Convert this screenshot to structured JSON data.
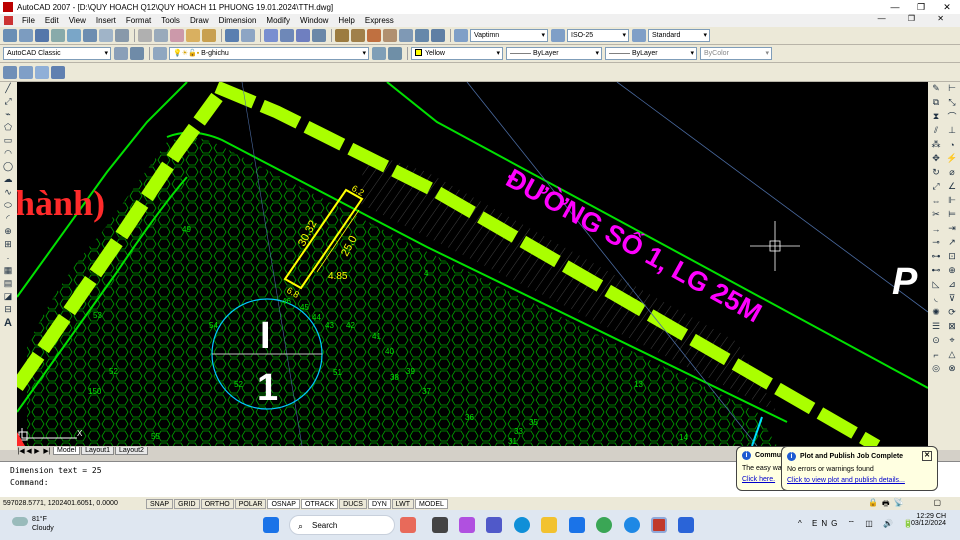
{
  "window": {
    "title": "AutoCAD 2007 - [D:\\QUY HOACH Q12\\QUY HOACH 11 PHUONG 19.01.2024\\TTH.dwg]",
    "controls": [
      "—",
      "❐",
      "✕"
    ]
  },
  "menu": {
    "items": [
      "File",
      "Edit",
      "View",
      "Insert",
      "Format",
      "Tools",
      "Draw",
      "Dimension",
      "Modify",
      "Window",
      "Help",
      "Express"
    ],
    "doc_controls": "— ❐ ✕"
  },
  "toolbars": {
    "text_style": "Vaptimn",
    "dim_style": "ISO-25",
    "table_style": "Standard",
    "workspace": "AutoCAD Classic",
    "layer": "B-ghichu",
    "color": "Yellow",
    "linetype": "ByLayer",
    "lineweight": "ByLayer",
    "plotstyle": "ByColor",
    "accent_yellow": "#ffff00"
  },
  "drawing": {
    "street_label": "ĐƯỜNG SỐ 1, LG 25M",
    "left_text": "hành)",
    "right_letter": "P",
    "block_roman": "I",
    "block_number": "1",
    "dims": {
      "a": "30.32",
      "b": "25.0",
      "c": "4.85",
      "d": "6.2",
      "e": "6.8"
    },
    "lot_numbers": [
      "49",
      "53",
      "54",
      "52",
      "46",
      "45",
      "44",
      "43",
      "42",
      "41",
      "40",
      "39",
      "38",
      "37",
      "36",
      "35",
      "33",
      "31",
      "51",
      "150",
      "55",
      "4",
      "13",
      "14",
      "52"
    ],
    "colors": {
      "road": "#aaff00",
      "boundary": "#00e000",
      "text": "#ff00ff",
      "yellow": "#ffff00",
      "white": "#ffffff",
      "red": "#ff2a2a"
    }
  },
  "layout_tabs": {
    "nav": [
      "|◀",
      "◀",
      "▶",
      "▶|"
    ],
    "tabs": [
      "Model",
      "Layout1",
      "Layout2"
    ]
  },
  "command": {
    "line1": "Dimension text = 25",
    "line2": "Command:"
  },
  "status": {
    "coords": "597028.5771, 1202401.6051, 0.0000",
    "buttons": [
      "SNAP",
      "GRID",
      "ORTHO",
      "POLAR",
      "OSNAP",
      "OTRACK",
      "DUCS",
      "DYN",
      "LWT",
      "MODEL"
    ],
    "on": [
      "OSNAP",
      "OTRACK",
      "DYN",
      "MODEL"
    ]
  },
  "balloon_back": {
    "title": "Commu",
    "text": "The easy wa",
    "link": "Click here."
  },
  "balloon": {
    "title": "Plot and Publish Job Complete",
    "text": "No errors or warnings found",
    "link": "Click to view plot and publish details...",
    "close": "✕"
  },
  "taskbar": {
    "temp": "81°F",
    "weather": "Cloudy",
    "search": "Search",
    "lang": "ENG",
    "time": "12:29 CH",
    "date": "03/12/2024",
    "tray_icons": "^  ENG  ⌔ ◫ 🔊 🔋"
  }
}
